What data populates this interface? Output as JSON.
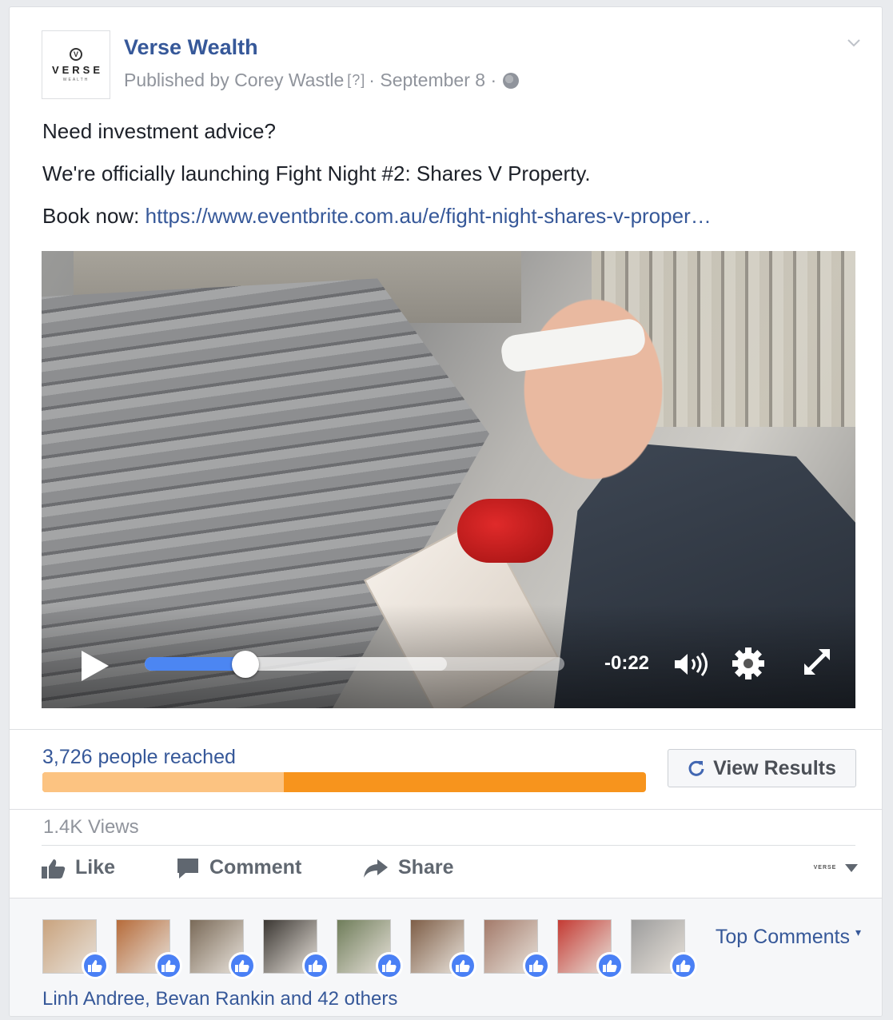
{
  "post": {
    "page_name": "Verse Wealth",
    "avatar": {
      "mark": "V",
      "word": "VERSE",
      "sub": "WEALTH"
    },
    "published_prefix": "Published by Corey Wastle",
    "help": "[?]",
    "separator": "·",
    "date": "September 8",
    "line1": "Need investment advice?",
    "line2": "We're officially launching Fight Night #2: Shares V Property.",
    "book_prefix": "Book now: ",
    "link": "https://www.eventbrite.com.au/e/fight-night-shares-v-proper…"
  },
  "video": {
    "time_remaining": "-0:22",
    "progress_fraction": 0.24,
    "buffered_fraction": 0.72,
    "icons": [
      "play-icon",
      "volume-icon",
      "gear-icon",
      "expand-icon"
    ]
  },
  "insights": {
    "reach": "3,726 people reached",
    "reach_split_fraction": 0.4,
    "view_results": "View Results",
    "colors": {
      "organic": "#fcc381",
      "paid": "#f7941d",
      "link": "#365899"
    }
  },
  "stats": {
    "views": "1.4K Views"
  },
  "actions": {
    "like": "Like",
    "comment": "Comment",
    "share": "Share"
  },
  "social": {
    "top_comments": "Top Comments",
    "likers": "Linh Andree, Bevan Rankin and 42 others",
    "faces": [
      "#c9a37e",
      "#b66b3a",
      "#7a6a58",
      "#3b3733",
      "#6f7d5a",
      "#7e5e47",
      "#a37a6a",
      "#c43a33",
      "#9d9d9d"
    ]
  }
}
